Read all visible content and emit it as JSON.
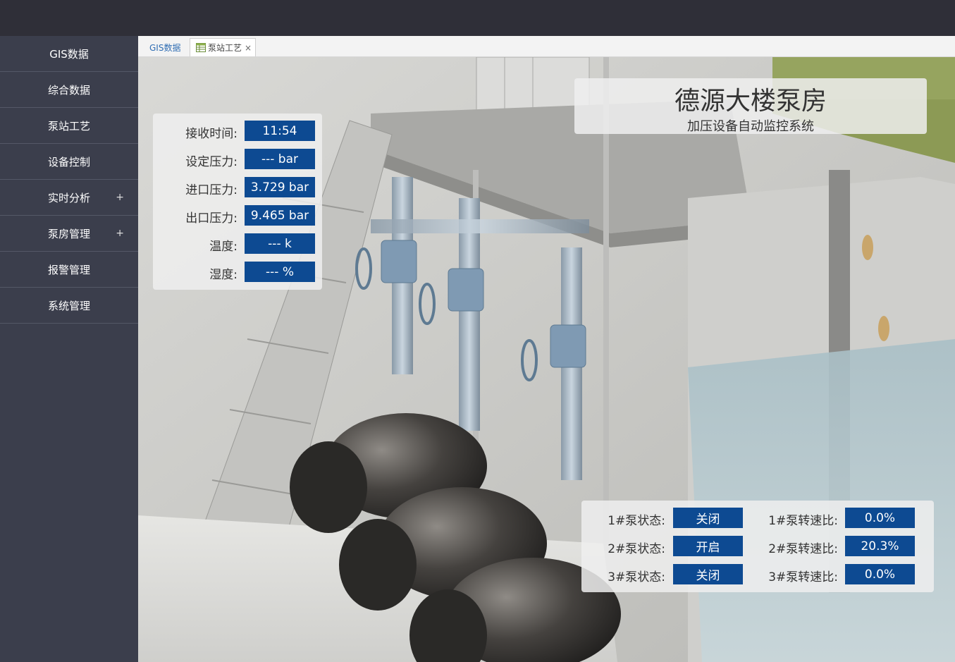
{
  "sidebar": {
    "items": [
      {
        "label": "GIS数据",
        "expand": ""
      },
      {
        "label": "综合数据",
        "expand": ""
      },
      {
        "label": "泵站工艺",
        "expand": ""
      },
      {
        "label": "设备控制",
        "expand": ""
      },
      {
        "label": "实时分析",
        "expand": "+"
      },
      {
        "label": "泵房管理",
        "expand": "+"
      },
      {
        "label": "报警管理",
        "expand": ""
      },
      {
        "label": "系统管理",
        "expand": ""
      }
    ]
  },
  "tabs": {
    "gis": "GIS数据",
    "pump": "泵站工艺",
    "close": "×"
  },
  "title": {
    "main": "德源大楼泵房",
    "sub": "加压设备自动监控系统"
  },
  "info": [
    {
      "label": "接收时间:",
      "value": "11:54"
    },
    {
      "label": "设定压力:",
      "value": "--- bar"
    },
    {
      "label": "进口压力:",
      "value": "3.729 bar"
    },
    {
      "label": "出口压力:",
      "value": "9.465 bar"
    },
    {
      "label": "温度:",
      "value": "--- k"
    },
    {
      "label": "湿度:",
      "value": "--- %"
    }
  ],
  "pumps": [
    {
      "status_label": "1#泵状态:",
      "status": "关闭",
      "ratio_label": "1#泵转速比:",
      "ratio": "0.0%"
    },
    {
      "status_label": "2#泵状态:",
      "status": "开启",
      "ratio_label": "2#泵转速比:",
      "ratio": "20.3%"
    },
    {
      "status_label": "3#泵状态:",
      "status": "关闭",
      "ratio_label": "3#泵转速比:",
      "ratio": "0.0%"
    }
  ],
  "colors": {
    "topbar": "#2f2f38",
    "sidebar": "#3b3e4c",
    "value_box": "#0d4a92",
    "tab_link": "#2f6db3"
  },
  "icons": {
    "pump_tab_icon": "table-icon",
    "close_icon": "close-icon"
  }
}
